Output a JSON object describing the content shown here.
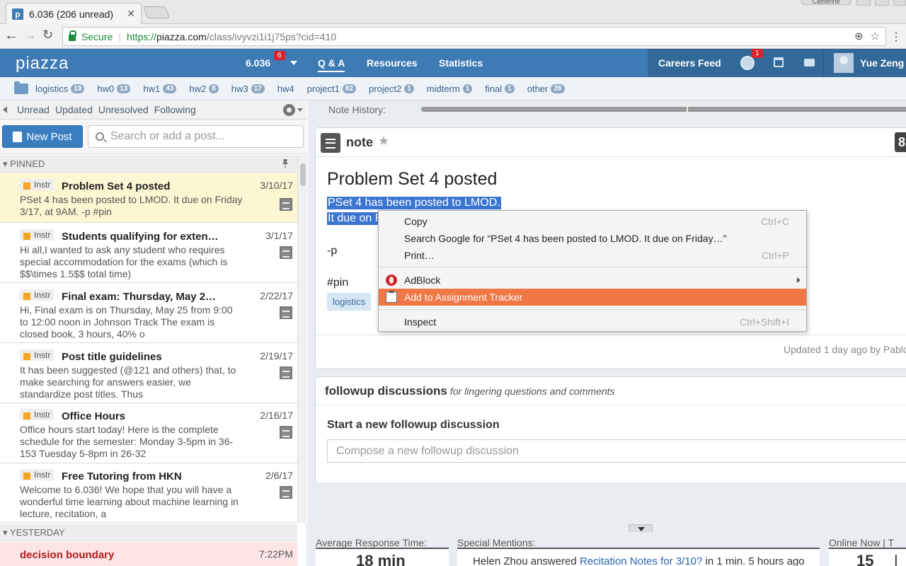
{
  "browser": {
    "tab_title": "6.036 (206 unread)",
    "tab_favicon": "p",
    "tab_close": "✕",
    "profile_name": "Catherine",
    "secure_label": "Secure",
    "url_https": "https://",
    "url_host": "piazza.com",
    "url_path": "/class/ivyvzi1i1j75ps?cid=410"
  },
  "header": {
    "logo": "piazza",
    "class_name": "6.036",
    "class_badge": "6",
    "nav": [
      "Q & A",
      "Resources",
      "Statistics"
    ],
    "careers": "Careers Feed",
    "notif_badge": "1",
    "user": "Yue Zeng"
  },
  "folders": [
    {
      "name": "logistics",
      "count": "19"
    },
    {
      "name": "hw0",
      "count": "13"
    },
    {
      "name": "hw1",
      "count": "43"
    },
    {
      "name": "hw2",
      "count": "8"
    },
    {
      "name": "hw3",
      "count": "17"
    },
    {
      "name": "hw4",
      "count": ""
    },
    {
      "name": "project1",
      "count": "82"
    },
    {
      "name": "project2",
      "count": "1"
    },
    {
      "name": "midterm",
      "count": "1"
    },
    {
      "name": "final",
      "count": "1"
    },
    {
      "name": "other",
      "count": "28"
    }
  ],
  "filters": [
    "Unread",
    "Updated",
    "Unresolved",
    "Following"
  ],
  "new_post_label": "New Post",
  "search_placeholder": "Search or add a post...",
  "groups": {
    "pinned": "▾ PINNED",
    "yesterday": "▾ YESTERDAY"
  },
  "instr_label": "Instr",
  "posts": [
    {
      "title": "Problem Set 4 posted",
      "date": "3/10/17",
      "snippet": "PSet 4 has been posted to LMOD. It due on Friday 3/17, at 9AM. -p #pin"
    },
    {
      "title": "Students qualifying for exten…",
      "date": "3/1/17",
      "snippet": "Hi all,I wanted to ask any student who requires special accommodation for the exams (which is $$\\times 1.5$$ total time)"
    },
    {
      "title": "Final exam: Thursday, May 2…",
      "date": "2/22/17",
      "snippet": "Hi, Final exam is on Thursday, May 25 from 9:00 to 12:00 noon in Johnson Track The exam is closed book, 3 hours, 40% o"
    },
    {
      "title": "Post title guidelines",
      "date": "2/19/17",
      "snippet": "It has been suggested (@121 and others) that, to make searching for answers easier, we standardize post titles. Thus"
    },
    {
      "title": "Office Hours",
      "date": "2/16/17",
      "snippet": "Office hours start today! Here is the complete schedule for the semester: Monday 3-5pm in 36-153 Tuesday 5-8pm in 26-32"
    },
    {
      "title": "Free Tutoring from HKN",
      "date": "2/6/17",
      "snippet": "Welcome to 6.036! We hope that you will have a wonderful time learning about machine learning in lecture, recitation, a"
    }
  ],
  "yesterday_post": {
    "title": "decision boundary",
    "date": "7:22PM"
  },
  "note": {
    "history_label": "Note History:",
    "type": "note",
    "star": "★",
    "count": "8",
    "title": "Problem Set 4 posted",
    "line1": "PSet 4 has been posted to LMOD.",
    "line2": "It due on F",
    "line3": "-p",
    "line4": "#pin",
    "tag": "logistics",
    "updated": "Updated 1 day ago by Pablo"
  },
  "followup": {
    "title": "followup discussions",
    "subtitle": "for lingering questions and comments",
    "start": "Start a new followup discussion",
    "placeholder": "Compose a new followup discussion"
  },
  "stats": {
    "response_label": "Average Response Time:",
    "response_value": "18 min",
    "mentions_label": "Special Mentions:",
    "mention_name": "Helen Zhou answered ",
    "mention_link": "Recitation Notes for 3/10?",
    "mention_tail": " in 1 min. 5 hours ago",
    "online_label": "Online Now  |  T",
    "online_value": "15",
    "online_sep": "|"
  },
  "context_menu": {
    "copy": "Copy",
    "copy_shortcut": "Ctrl+C",
    "search": "Search Google for “PSet 4 has been posted to LMOD. It due on Friday…”",
    "print": "Print…",
    "print_shortcut": "Ctrl+P",
    "adblock": "AdBlock",
    "tracker": "Add to Assignment Tracker",
    "inspect": "Inspect",
    "inspect_shortcut": "Ctrl+Shift+I"
  }
}
